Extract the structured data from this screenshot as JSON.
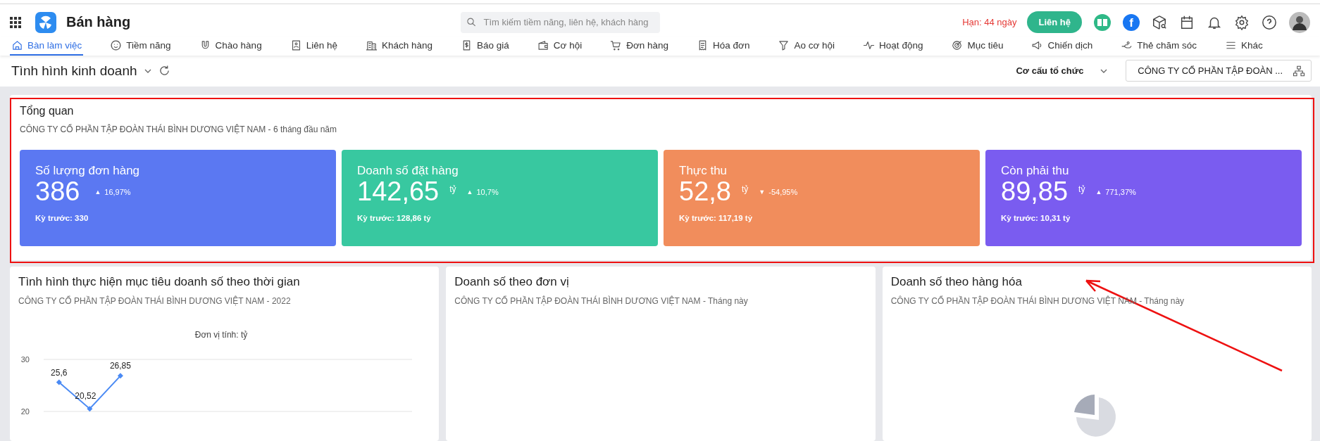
{
  "app": {
    "title": "Bán hàng"
  },
  "search": {
    "placeholder": "Tìm kiếm tiềm năng, liên hệ, khách hàng"
  },
  "topbar": {
    "deadline": "Hạn: 44 ngày",
    "contact_button": "Liên hệ",
    "facebook_letter": "f"
  },
  "nav": [
    {
      "label": "Bàn làm việc",
      "selected": true
    },
    {
      "label": "Tiềm năng",
      "selected": false
    },
    {
      "label": "Chào hàng",
      "selected": false
    },
    {
      "label": "Liên hệ",
      "selected": false
    },
    {
      "label": "Khách hàng",
      "selected": false
    },
    {
      "label": "Báo giá",
      "selected": false
    },
    {
      "label": "Cơ hội",
      "selected": false
    },
    {
      "label": "Đơn hàng",
      "selected": false
    },
    {
      "label": "Hóa đơn",
      "selected": false
    },
    {
      "label": "Ao cơ hội",
      "selected": false
    },
    {
      "label": "Hoạt động",
      "selected": false
    },
    {
      "label": "Mục tiêu",
      "selected": false
    },
    {
      "label": "Chiến dịch",
      "selected": false
    },
    {
      "label": "Thẻ chăm sóc",
      "selected": false
    },
    {
      "label": "Khác",
      "selected": false
    }
  ],
  "page": {
    "title": "Tình hình kinh doanh",
    "org_label": "Cơ cấu tổ chức",
    "org_value": "CÔNG TY CỔ PHẦN TẬP ĐOÀN ..."
  },
  "overview": {
    "title": "Tổng quan",
    "subtitle": "CÔNG TY CỔ PHẦN TẬP ĐOÀN THÁI BÌNH DƯƠNG VIỆT NAM - 6 tháng đầu năm",
    "stats": [
      {
        "label": "Số lượng đơn hàng",
        "value": "386",
        "trend": "▲",
        "change": "16,97%",
        "previous": "Kỳ trước: 330",
        "color": "#5b78f2"
      },
      {
        "label": "Doanh số đặt hàng",
        "value": "142,65",
        "unit": "tỷ",
        "trend": "▲",
        "change": "10,7%",
        "previous": "Kỳ trước: 128,86 tỷ",
        "color": "#38c8a0"
      },
      {
        "label": "Thực thu",
        "value": "52,8",
        "unit": "tỷ",
        "trend": "▼",
        "change": "-54,95%",
        "previous": "Kỳ trước: 117,19 tỷ",
        "color": "#f18d5c"
      },
      {
        "label": "Còn phải thu",
        "value": "89,85",
        "unit": "tỷ",
        "trend": "▲",
        "change": "771,37%",
        "previous": "Kỳ trước: 10,31 tỷ",
        "color": "#7a5cf0"
      }
    ]
  },
  "panels": [
    {
      "kind": "line",
      "title": "Tình hình thực hiện mục tiêu doanh số theo thời gian",
      "subtitle": "CÔNG TY CỔ PHẦN TẬP ĐOÀN THÁI BÌNH DƯƠNG VIỆT NAM - 2022",
      "chart_data": {
        "type": "line",
        "title": "Đơn vị tính: tỷ",
        "series": [
          {
            "color": "#4a8af4",
            "marker": "diamond",
            "values": [
              25.6,
              20.52,
              26.85,
              null,
              null,
              null,
              null,
              null,
              null,
              null,
              null,
              null
            ]
          }
        ],
        "value_labels": [
          "25,6",
          "20,52",
          "26,85"
        ],
        "ylim": [
          20,
          30
        ],
        "yticks": [
          20,
          30
        ]
      }
    },
    {
      "kind": "blank",
      "title": "Doanh số theo đơn vị",
      "subtitle": "CÔNG TY CỔ PHẦN TẬP ĐOÀN THÁI BÌNH DƯƠNG VIỆT NAM - Tháng này"
    },
    {
      "kind": "empty",
      "title": "Doanh số theo hàng hóa",
      "subtitle": "CÔNG TY CỔ PHẦN TẬP ĐOÀN THÁI BÌNH DƯƠNG VIỆT NAM - Tháng này"
    }
  ]
}
